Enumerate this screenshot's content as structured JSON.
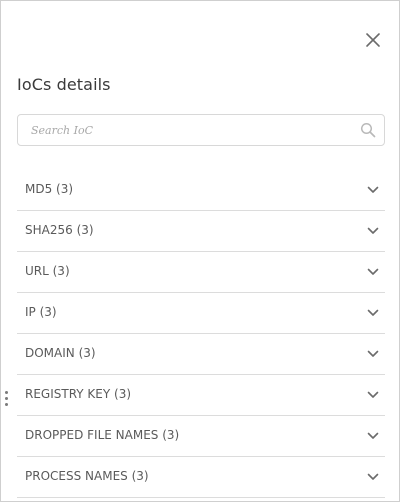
{
  "panel": {
    "title": "IoCs details",
    "close_icon": "close-icon"
  },
  "search": {
    "placeholder": "Search IoC",
    "value": "",
    "icon": "search-icon"
  },
  "ioc_sections": [
    {
      "label": "MD5 (3)"
    },
    {
      "label": "SHA256 (3)"
    },
    {
      "label": "URL (3)"
    },
    {
      "label": "IP (3)"
    },
    {
      "label": "DOMAIN (3)"
    },
    {
      "label": "REGISTRY KEY (3)"
    },
    {
      "label": "DROPPED FILE NAMES (3)"
    },
    {
      "label": "PROCESS NAMES (3)"
    }
  ],
  "colors": {
    "text": "#5a5a5a",
    "title": "#3a3a3a",
    "border": "#dcdcdc",
    "icon": "#6b6b6b"
  }
}
